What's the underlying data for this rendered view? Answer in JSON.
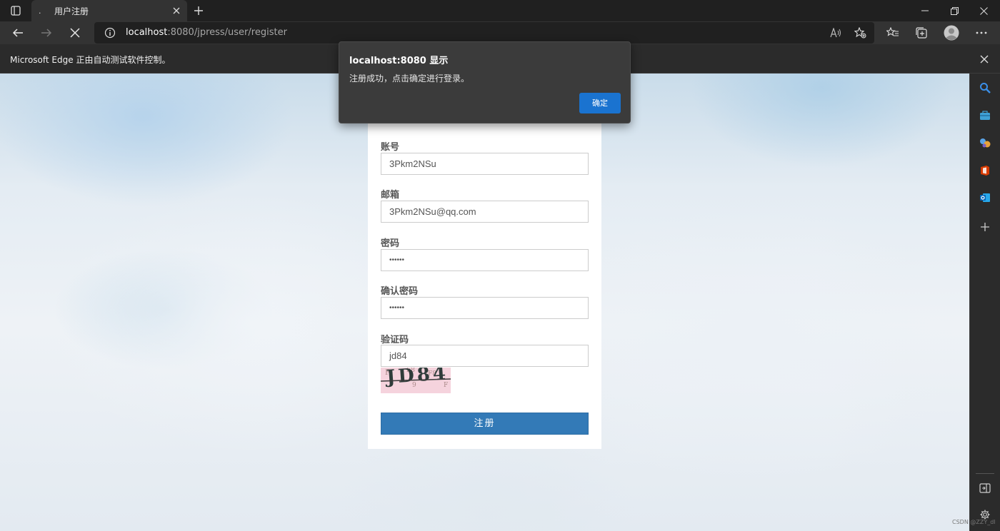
{
  "tab": {
    "favicon": ".",
    "title": "用户注册"
  },
  "address": {
    "host": "localhost",
    "rest": ":8080/jpress/user/register"
  },
  "infobar": {
    "text": "Microsoft Edge 正由自动测试软件控制。"
  },
  "dialog": {
    "title": "localhost:8080 显示",
    "message": "注册成功，点击确定进行登录。",
    "ok_label": "确定"
  },
  "form": {
    "account_label": "账号",
    "account_value": "3Pkm2NSu",
    "email_label": "邮箱",
    "email_value": "3Pkm2NSu@qq.com",
    "password_label": "密码",
    "password_value": "••••••",
    "confirm_label": "确认密码",
    "confirm_value": "••••••",
    "captcha_label": "验证码",
    "captcha_value": "jd84",
    "captcha_image_text": "JD84",
    "submit_label": "注册"
  },
  "watermark": "CSDN @ZZY_dl",
  "colors": {
    "accent": "#337ab7",
    "dialog_button": "#1a73d0",
    "chrome_dark": "#202020"
  },
  "icons": [
    "tab-actions-icon",
    "close-icon",
    "plus-icon",
    "minimize-icon",
    "restore-icon",
    "back-arrow-icon",
    "forward-arrow-icon",
    "stop-icon",
    "info-icon",
    "read-aloud-icon",
    "add-favorite-icon",
    "favorites-icon",
    "collections-icon",
    "profile-icon",
    "more-icon",
    "search-icon",
    "briefcase-icon",
    "games-icon",
    "office-icon",
    "outlook-icon",
    "add-icon",
    "sidebar-toggle-icon",
    "settings-icon"
  ]
}
